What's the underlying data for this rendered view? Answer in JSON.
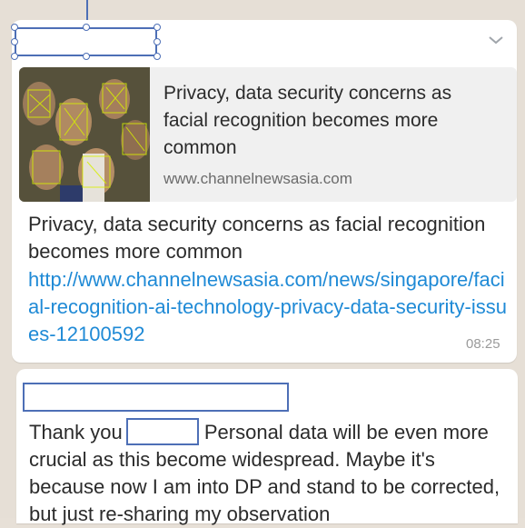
{
  "message1": {
    "preview_title": "Privacy, data security concerns as facial recognition becomes more common",
    "preview_domain": "www.channelnewsasia.com",
    "text": "Privacy, data security concerns as facial recognition becomes more common",
    "link": "http://www.channelnewsasia.com/news/singapore/facial-recognition-ai-technology-privacy-data-security-issues-12100592",
    "time": "08:25"
  },
  "message2": {
    "text_before_redaction": "Thank you",
    "text_after_redaction": "Personal data will be even more crucial as this become widespread. Maybe it's because now I am into DP and stand to be corrected, but just re-sharing my observation"
  },
  "colors": {
    "link": "#1f8ad6",
    "selection": "#4d6fb6",
    "bubble": "#ffffff",
    "chat_background": "#e6dfd6"
  },
  "icons": {
    "menu": "chevron-down-icon"
  }
}
